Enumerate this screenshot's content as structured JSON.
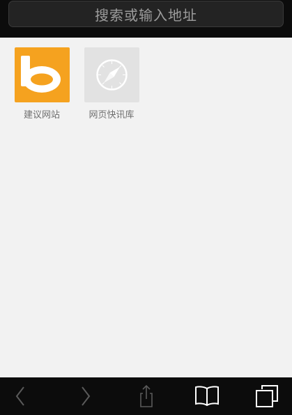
{
  "search": {
    "placeholder": "搜索或输入地址"
  },
  "speed_dial": [
    {
      "label": "建议网站",
      "icon": "bing-logo-icon",
      "color": "#f5a21f"
    },
    {
      "label": "网页快讯库",
      "icon": "safari-compass-icon",
      "color": "#e2e2e2"
    }
  ],
  "toolbar": {
    "buttons": [
      {
        "icon": "back-arrow-icon",
        "enabled": false
      },
      {
        "icon": "forward-arrow-icon",
        "enabled": false
      },
      {
        "icon": "share-icon",
        "enabled": false
      },
      {
        "icon": "bookmarks-book-icon",
        "enabled": true
      },
      {
        "icon": "tabs-pages-icon",
        "enabled": true
      }
    ]
  },
  "colors": {
    "bar_background": "#0c0c0c",
    "content_background": "#f2f2f2",
    "icon_enabled": "#ffffff",
    "icon_disabled": "#5a5a5a"
  }
}
